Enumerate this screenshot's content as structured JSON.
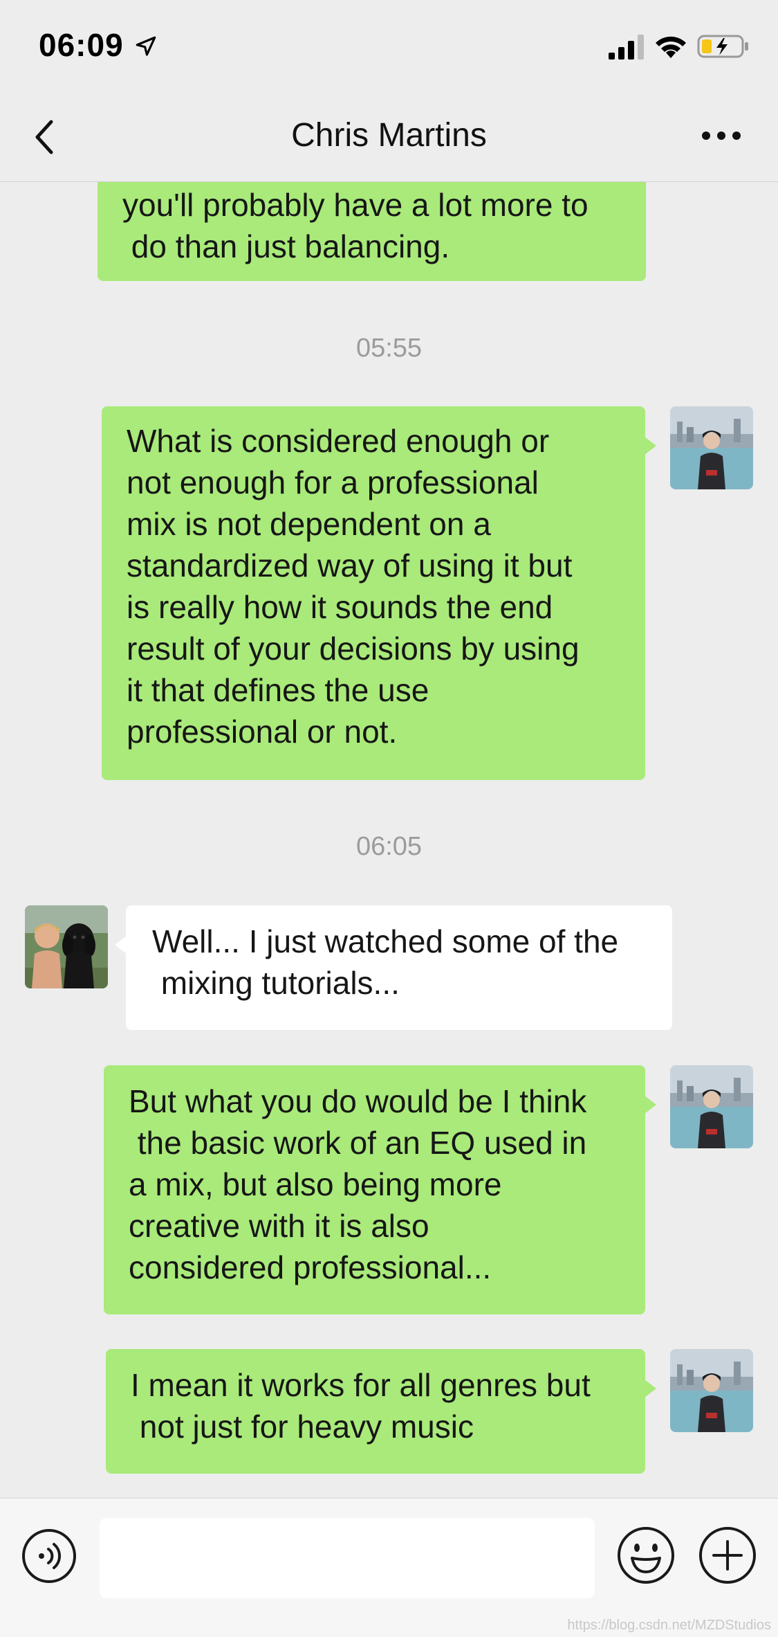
{
  "status_bar": {
    "time": "06:09",
    "icons": [
      "location-arrow-icon",
      "cellular-signal-icon",
      "wifi-icon",
      "battery-charging-icon"
    ]
  },
  "nav": {
    "title": "Chris Martins",
    "back_icon": "chevron-left-icon",
    "more_icon": "more-dots-icon"
  },
  "messages": {
    "m0": {
      "sender": "me",
      "text": "you'll probably have a lot more to\n do than just balancing."
    },
    "t1": "05:55",
    "m1": {
      "sender": "me",
      "text": "What is considered enough or\nnot enough for a professional\nmix is not dependent on a\nstandardized way of using it but\nis really how it sounds the end\nresult of your decisions by using\nit that defines the use\nprofessional or not."
    },
    "t2": "06:05",
    "m2": {
      "sender": "them",
      "text": "Well... I just watched some of the\n mixing tutorials..."
    },
    "m3": {
      "sender": "me",
      "text": "But what you do would be I think\n the basic work of an EQ used in\na mix, but also being more\ncreative with it is also\nconsidered professional..."
    },
    "m4": {
      "sender": "me",
      "text": "I mean it works for all genres but\n not just for heavy music"
    }
  },
  "input_bar": {
    "placeholder": "",
    "icons": [
      "voice-icon",
      "emoji-icon",
      "plus-icon"
    ]
  },
  "colors": {
    "background": "#EDEDED",
    "my_bubble": "#A9EA7A",
    "their_bubble": "#FFFFFF",
    "timestamp": "#9B9B9B"
  },
  "watermark": "https://blog.csdn.net/MZDStudios"
}
